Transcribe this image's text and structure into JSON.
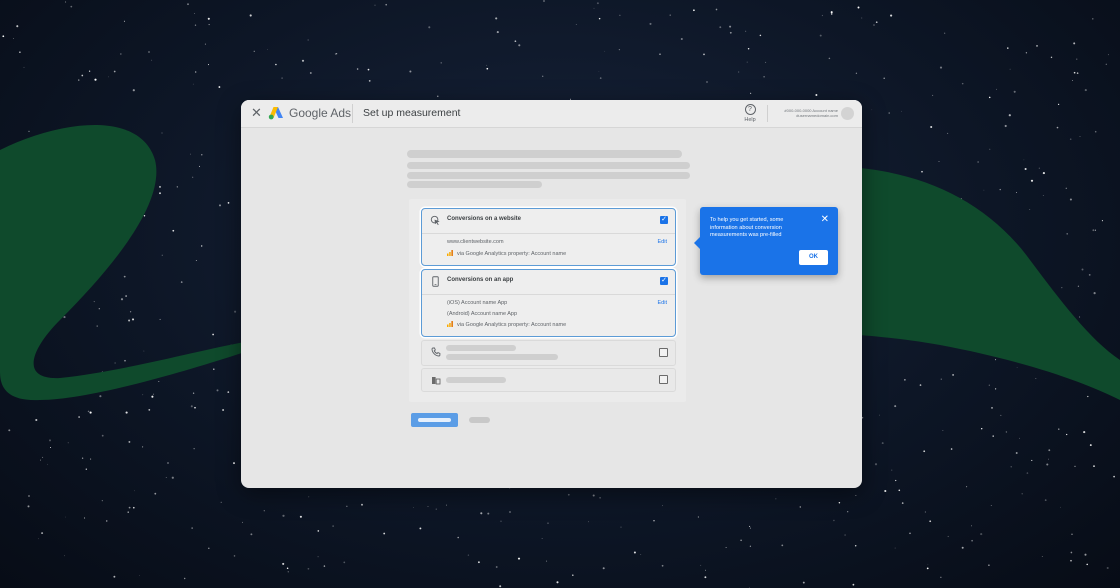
{
  "colors": {
    "background": "#0d1626",
    "swoosh": "#0f4a2c",
    "accent": "#1a73e8",
    "window": "#e6e6e6"
  },
  "topbar": {
    "close_icon": "close-icon",
    "brand_google": "Google",
    "brand_ads": "Ads",
    "page_title": "Set up measurement",
    "help_label": "Help",
    "account_line1": "#000-000-0000 Account name",
    "account_line2": "#usernamedomain.com"
  },
  "cards": [
    {
      "title": "Conversions on a website",
      "icon": "cursor-click-icon",
      "checked": true,
      "edit_label": "Edit",
      "lines": [
        "www.clientwebsite.com"
      ],
      "ga_line": "via Google Analytics property: Account name"
    },
    {
      "title": "Conversions on an app",
      "icon": "phone-icon",
      "checked": true,
      "edit_label": "Edit",
      "lines": [
        "(iOS) Account name App",
        "(Android) Account name App"
      ],
      "ga_line": "via Google Analytics property: Account name"
    }
  ],
  "rows": [
    {
      "icon": "phone-call-icon",
      "checked": false
    },
    {
      "icon": "store-icon",
      "checked": false
    }
  ],
  "tooltip": {
    "text": "To help you get started, some information about conversion measurements was pre-filled",
    "ok_label": "OK"
  }
}
